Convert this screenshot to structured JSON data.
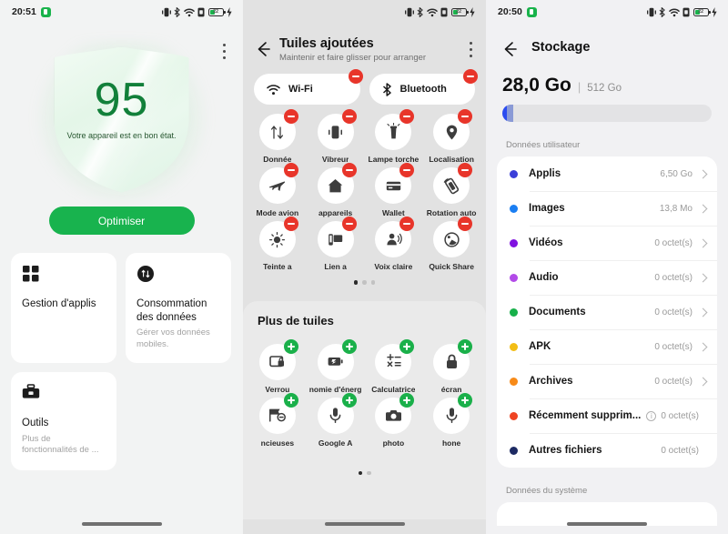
{
  "screens": {
    "left": {
      "statusbar": {
        "time": "20:51",
        "battery_pct": "22"
      },
      "score": "95",
      "score_caption": "Votre appareil est en bon état.",
      "optimize_button": "Optimiser",
      "cards": [
        {
          "title": "Gestion d'applis",
          "desc": "",
          "icon": "grid-icon"
        },
        {
          "title": "Consommation des données",
          "desc": "Gérer vos données mobiles.",
          "icon": "data-usage-icon"
        },
        {
          "title": "Outils",
          "desc": "Plus de fonctionnalités de ...",
          "icon": "toolbox-icon"
        }
      ]
    },
    "mid": {
      "statusbar": {
        "time": "",
        "battery_pct": "22"
      },
      "title": "Tuiles ajoutées",
      "subtitle": "Maintenir et faire glisser pour arranger",
      "pills": [
        {
          "label": "Wi-Fi",
          "icon": "wifi-icon",
          "badge": "minus"
        },
        {
          "label": "Bluetooth",
          "icon": "bluetooth-icon",
          "badge": "minus"
        }
      ],
      "added_tiles": [
        {
          "label": "Donnée",
          "icon": "data-transfer-icon"
        },
        {
          "label": "Vibreur",
          "icon": "vibrate-icon"
        },
        {
          "label": "Lampe torche",
          "icon": "flashlight-icon"
        },
        {
          "label": "Localisation",
          "icon": "location-pin-icon"
        },
        {
          "label": "Mode avion",
          "icon": "airplane-icon"
        },
        {
          "label": "appareils",
          "icon": "home-icon"
        },
        {
          "label": "Wallet",
          "icon": "card-icon"
        },
        {
          "label": "Rotation auto",
          "icon": "auto-rotate-icon"
        },
        {
          "label": "Teinte a",
          "icon": "eye-comfort-icon"
        },
        {
          "label": "Lien a",
          "icon": "link-to-windows-icon"
        },
        {
          "label": "Voix claire",
          "icon": "clear-voice-icon"
        },
        {
          "label": "Quick Share",
          "icon": "quick-share-icon"
        }
      ],
      "added_pages": {
        "count": 3,
        "active": 0
      },
      "more_title": "Plus de tuiles",
      "more_tiles": [
        {
          "label": "Verrou",
          "icon": "screen-lock-icon"
        },
        {
          "label": "nomie d'énerg",
          "icon": "battery-saver-icon"
        },
        {
          "label": "Calculatrice",
          "icon": "calculator-icon"
        },
        {
          "label": "écran",
          "icon": "lock-icon"
        },
        {
          "label": "ncieuses",
          "icon": "flag-block-icon"
        },
        {
          "label": "Google A",
          "icon": "microphone-icon"
        },
        {
          "label": "photo",
          "icon": "camera-icon"
        },
        {
          "label": "hone",
          "icon": "microphone-icon"
        }
      ],
      "more_pages": {
        "count": 2,
        "active": 0
      }
    },
    "right": {
      "statusbar": {
        "time": "20:50",
        "battery_pct": "22"
      },
      "title": "Stockage",
      "used": "28,0 Go",
      "separator": "|",
      "total": "512 Go",
      "user_data_label": "Données utilisateur",
      "system_data_label": "Données du système",
      "items": [
        {
          "label": "Applis",
          "value": "6,50 Go",
          "color": "#3b3fd8",
          "chevron": true,
          "info": false
        },
        {
          "label": "Images",
          "value": "13,8 Mo",
          "color": "#1a7ef2",
          "chevron": true,
          "info": false
        },
        {
          "label": "Vidéos",
          "value": "0 octet(s)",
          "color": "#8012e0",
          "chevron": true,
          "info": false
        },
        {
          "label": "Audio",
          "value": "0 octet(s)",
          "color": "#b24ae8",
          "chevron": true,
          "info": false
        },
        {
          "label": "Documents",
          "value": "0 octet(s)",
          "color": "#17b04a",
          "chevron": true,
          "info": false
        },
        {
          "label": "APK",
          "value": "0 octet(s)",
          "color": "#f2bd15",
          "chevron": true,
          "info": false
        },
        {
          "label": "Archives",
          "value": "0 octet(s)",
          "color": "#f78a18",
          "chevron": true,
          "info": false
        },
        {
          "label": "Récemment supprim...",
          "value": "0 octet(s)",
          "color": "#ef4423",
          "chevron": false,
          "info": true
        },
        {
          "label": "Autres fichiers",
          "value": "0 octet(s)",
          "color": "#1d2a63",
          "chevron": false,
          "info": false
        }
      ]
    }
  },
  "colors": {
    "accent_green": "#18b34e",
    "badge_remove": "#e8352a",
    "badge_add": "#1ab04a",
    "storage_blue": "#2b4cf0"
  }
}
